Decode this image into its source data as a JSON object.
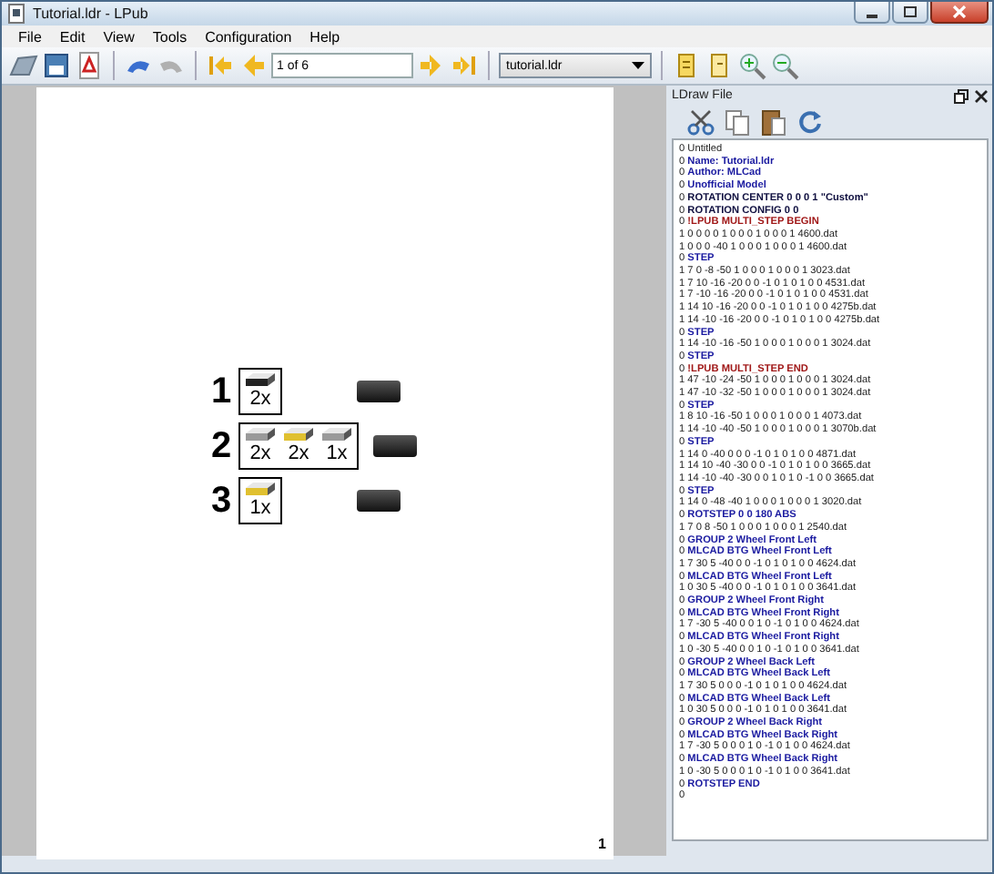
{
  "window": {
    "title": "Tutorial.ldr - LPub"
  },
  "menu": [
    "File",
    "Edit",
    "View",
    "Tools",
    "Configuration",
    "Help"
  ],
  "toolbar": {
    "page_field": "1 of 6",
    "file_combo": "tutorial.ldr"
  },
  "page": {
    "steps": [
      {
        "number": "1",
        "parts": [
          {
            "count": "2x",
            "color": "#222222"
          }
        ]
      },
      {
        "number": "2",
        "parts": [
          {
            "count": "2x",
            "color": "#9a9a9a"
          },
          {
            "count": "2x",
            "color": "#e0c030"
          },
          {
            "count": "1x",
            "color": "#9a9a9a"
          }
        ]
      },
      {
        "number": "3",
        "parts": [
          {
            "count": "1x",
            "color": "#e0c030"
          }
        ]
      }
    ],
    "page_number": "1"
  },
  "dock": {
    "title": "LDraw File",
    "lines": [
      {
        "kind": "comment",
        "prefix": "0",
        "text": "Untitled"
      },
      {
        "kind": "meta",
        "prefix": "0",
        "text": "Name: Tutorial.ldr"
      },
      {
        "kind": "meta",
        "prefix": "0",
        "text": "Author: MLCad"
      },
      {
        "kind": "meta",
        "prefix": "0",
        "text": "Unofficial Model"
      },
      {
        "kind": "rotation",
        "prefix": "0",
        "text": "ROTATION CENTER 0 0 0 1 \"Custom\""
      },
      {
        "kind": "rotation",
        "prefix": "0",
        "text": "ROTATION CONFIG 0 0"
      },
      {
        "kind": "lpub",
        "prefix": "0",
        "text": "!LPUB MULTI_STEP BEGIN"
      },
      {
        "kind": "part",
        "text": "1 0 0 0 0 1 0 0 0 1 0 0 0 1 4600.dat"
      },
      {
        "kind": "part",
        "text": "1 0 0 0 -40 1 0 0 0 1 0 0 0 1 4600.dat"
      },
      {
        "kind": "meta",
        "prefix": "0",
        "text": "STEP"
      },
      {
        "kind": "part",
        "text": "1 7 0 -8 -50 1 0 0 0 1 0 0 0 1 3023.dat"
      },
      {
        "kind": "part",
        "text": "1 7 10 -16 -20 0 0 -1 0 1 0 1 0 0 4531.dat"
      },
      {
        "kind": "part",
        "text": "1 7 -10 -16 -20 0 0 -1 0 1 0 1 0 0 4531.dat"
      },
      {
        "kind": "part",
        "text": "1 14 10 -16 -20 0 0 -1 0 1 0 1 0 0 4275b.dat"
      },
      {
        "kind": "part",
        "text": "1 14 -10 -16 -20 0 0 -1 0 1 0 1 0 0 4275b.dat"
      },
      {
        "kind": "meta",
        "prefix": "0",
        "text": "STEP"
      },
      {
        "kind": "part",
        "text": "1 14 -10 -16 -50 1 0 0 0 1 0 0 0 1 3024.dat"
      },
      {
        "kind": "meta",
        "prefix": "0",
        "text": "STEP"
      },
      {
        "kind": "lpub",
        "prefix": "0",
        "text": "!LPUB MULTI_STEP END"
      },
      {
        "kind": "part",
        "text": "1 47 -10 -24 -50 1 0 0 0 1 0 0 0 1 3024.dat"
      },
      {
        "kind": "part",
        "text": "1 47 -10 -32 -50 1 0 0 0 1 0 0 0 1 3024.dat"
      },
      {
        "kind": "meta",
        "prefix": "0",
        "text": "STEP"
      },
      {
        "kind": "part",
        "text": "1 8 10 -16 -50 1 0 0 0 1 0 0 0 1 4073.dat"
      },
      {
        "kind": "part",
        "text": "1 14 -10 -40 -50 1 0 0 0 1 0 0 0 1 3070b.dat"
      },
      {
        "kind": "meta",
        "prefix": "0",
        "text": "STEP"
      },
      {
        "kind": "part",
        "text": "1 14 0 -40 0 0 0 -1 0 1 0 1 0 0 4871.dat"
      },
      {
        "kind": "part",
        "text": "1 14 10 -40 -30 0 0 -1 0 1 0 1 0 0 3665.dat"
      },
      {
        "kind": "part",
        "text": "1 14 -10 -40 -30 0 0 1 0 1 0 -1 0 0 3665.dat"
      },
      {
        "kind": "meta",
        "prefix": "0",
        "text": "STEP"
      },
      {
        "kind": "part",
        "text": "1 14 0 -48 -40 1 0 0 0 1 0 0 0 1 3020.dat"
      },
      {
        "kind": "meta",
        "prefix": "0",
        "text": "ROTSTEP 0 0 180 ABS"
      },
      {
        "kind": "part",
        "text": "1 7 0 8 -50 1 0 0 0 1 0 0 0 1 2540.dat"
      },
      {
        "kind": "meta",
        "prefix": "0",
        "text": "GROUP 2 Wheel Front Left"
      },
      {
        "kind": "meta",
        "prefix": "0",
        "text": "MLCAD BTG Wheel Front Left"
      },
      {
        "kind": "part",
        "text": "1 7 30 5 -40 0 0 -1 0 1 0 1 0 0 4624.dat"
      },
      {
        "kind": "meta",
        "prefix": "0",
        "text": "MLCAD BTG Wheel Front Left"
      },
      {
        "kind": "part",
        "text": "1 0 30 5 -40 0 0 -1 0 1 0 1 0 0 3641.dat"
      },
      {
        "kind": "meta",
        "prefix": "0",
        "text": "GROUP 2 Wheel Front Right"
      },
      {
        "kind": "meta",
        "prefix": "0",
        "text": "MLCAD BTG Wheel Front Right"
      },
      {
        "kind": "part",
        "text": "1 7 -30 5 -40 0 0 1 0 -1 0 1 0 0 4624.dat"
      },
      {
        "kind": "meta",
        "prefix": "0",
        "text": "MLCAD BTG Wheel Front Right"
      },
      {
        "kind": "part",
        "text": "1 0 -30 5 -40 0 0 1 0 -1 0 1 0 0 3641.dat"
      },
      {
        "kind": "meta",
        "prefix": "0",
        "text": "GROUP 2 Wheel Back Left"
      },
      {
        "kind": "meta",
        "prefix": "0",
        "text": "MLCAD BTG Wheel Back Left"
      },
      {
        "kind": "part",
        "text": "1 7 30 5 0 0 0 -1 0 1 0 1 0 0 4624.dat"
      },
      {
        "kind": "meta",
        "prefix": "0",
        "text": "MLCAD BTG Wheel Back Left"
      },
      {
        "kind": "part",
        "text": "1 0 30 5 0 0 0 -1 0 1 0 1 0 0 3641.dat"
      },
      {
        "kind": "meta",
        "prefix": "0",
        "text": "GROUP 2 Wheel Back Right"
      },
      {
        "kind": "meta",
        "prefix": "0",
        "text": "MLCAD BTG Wheel Back Right"
      },
      {
        "kind": "part",
        "text": "1 7 -30 5 0 0 0 1 0 -1 0 1 0 0 4624.dat"
      },
      {
        "kind": "meta",
        "prefix": "0",
        "text": "MLCAD BTG Wheel Back Right"
      },
      {
        "kind": "part",
        "text": "1 0 -30 5 0 0 0 1 0 -1 0 1 0 0 3641.dat"
      },
      {
        "kind": "meta",
        "prefix": "0",
        "text": "ROTSTEP END"
      },
      {
        "kind": "part",
        "text": "0"
      }
    ]
  }
}
